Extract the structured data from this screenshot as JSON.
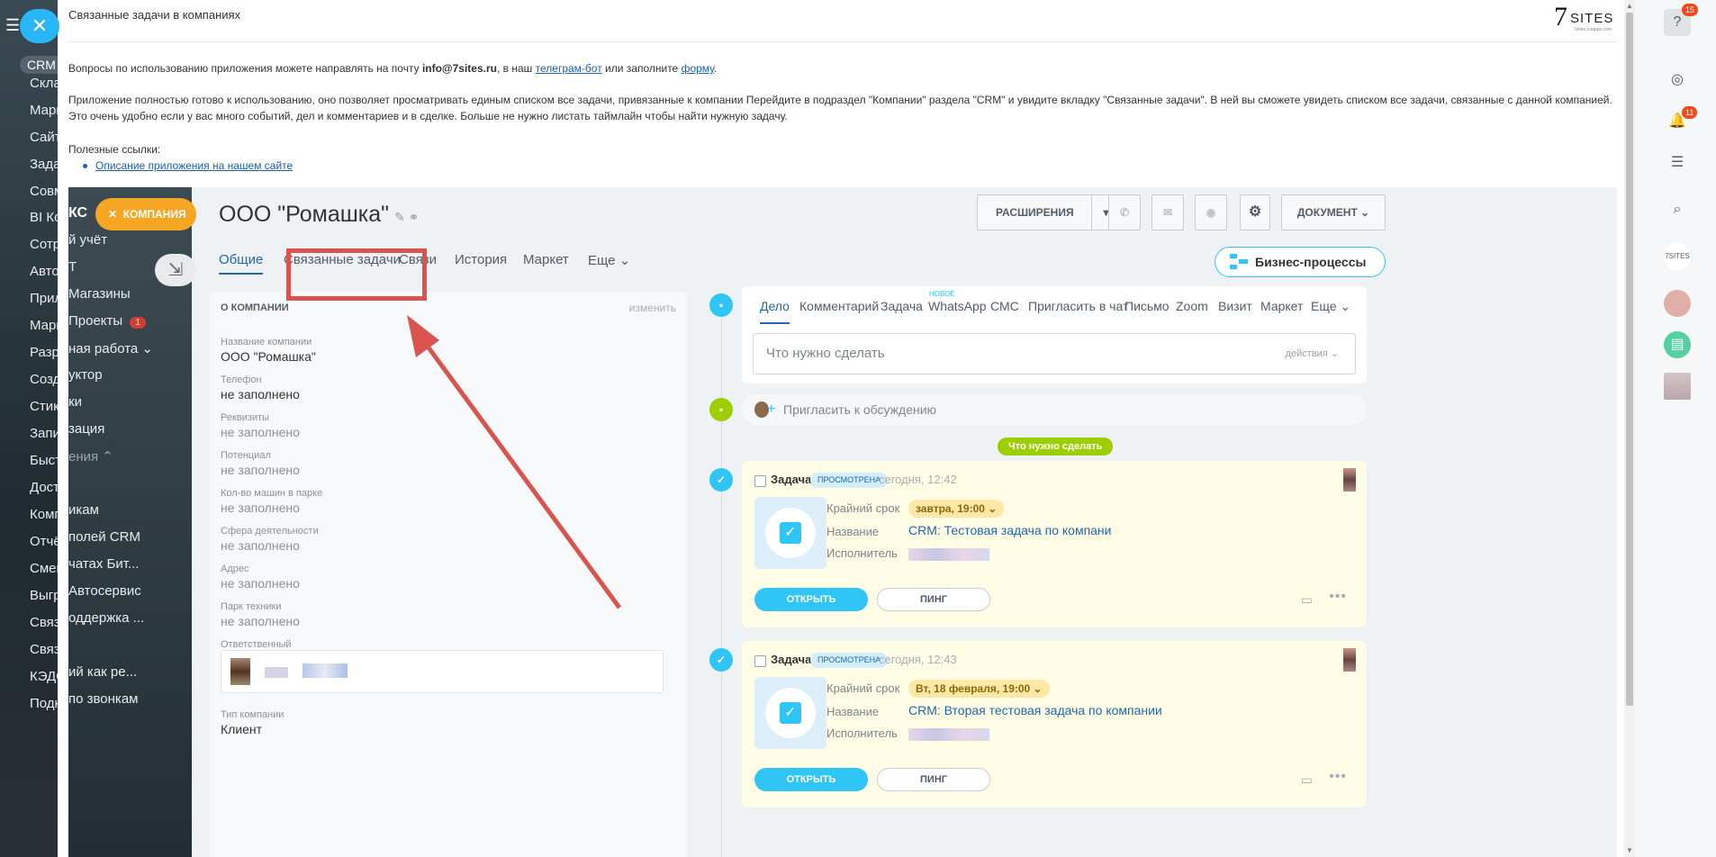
{
  "app": {
    "title": "Связанные задачи в компаниях",
    "logo": {
      "mark": "7",
      "word": "SITES",
      "sub": "7sites.ru/apps.com"
    }
  },
  "intro": {
    "p1_a": "Вопросы по использованию приложения можете направлять на почту ",
    "email": "info@7sites.ru",
    "p1_b": ", в наш ",
    "bot_link": "телеграм-бот",
    "p1_c": " или заполните ",
    "form_link": "форму",
    "p1_d": ".",
    "p2": "Приложение полностью готово к использованию, оно позволяет просматривать единым списком все задачи, привязанные к компании Перейдите в подраздел \"Компании\" раздела \"CRM\" и увидите вкладку \"Связанные задачи\". В ней вы сможете увидеть списком все задачи, связанные с данной компанией. Это очень удобно если у вас много событий, дел и комментариев и в сделке. Больше не нужно листать таймлайн чтобы найти нужную задачу.",
    "p3": "Полезные ссылки:",
    "link1": "Описание приложения на нашем сайте"
  },
  "bg_sidebar": {
    "crm": "CRM",
    "items": [
      "Склад",
      "Маркетинг",
      "Сайты",
      "Задачи",
      "Совместная работа",
      "BI Конструктор",
      "Сотрудники",
      "Автоматизация",
      "Приложения",
      "Маркет",
      "Разработчикам",
      "Создатель",
      "Стикеры",
      "Запись",
      "Быстрые",
      "Доступ",
      "Компании",
      "Отчёты",
      "Смена",
      "Выгрузка",
      "Связь",
      "Связь BI",
      "КЭДО",
      "Подключения"
    ]
  },
  "inner_sidebar": {
    "ks": "КС",
    "company_badge": "КОМПАНИЯ",
    "items": [
      {
        "label": "й учёт"
      },
      {
        "label": "Т"
      },
      {
        "label": "Магазины"
      },
      {
        "label": "Проекты",
        "badge": "1"
      },
      {
        "label": "ная работа ⌄"
      },
      {
        "label": "уктор"
      },
      {
        "label": "ки"
      },
      {
        "label": "зация"
      },
      {
        "label": "ения ⌃"
      },
      {
        "label": "икам"
      },
      {
        "label": "полей CRM"
      },
      {
        "label": "чатах Бит..."
      },
      {
        "label": "Автосервис"
      },
      {
        "label": "оддержка ..."
      },
      {
        "label": "ий как ре..."
      },
      {
        "label": "по звонкам"
      }
    ]
  },
  "company": {
    "title": "ООО \"Ромашка\"",
    "toolbar": {
      "extensions": "РАСШИРЕНИЯ",
      "document": "ДОКУМЕНТ"
    },
    "tabs": [
      "Общие",
      "Связанные задачи",
      "Связи",
      "История",
      "Маркет",
      "Еще"
    ],
    "bp_button": "Бизнес-процессы"
  },
  "about": {
    "header": "О КОМПАНИИ",
    "edit": "изменить",
    "fields": [
      {
        "label": "Название компании",
        "value": "ООО \"Ромашка\"",
        "empty": false
      },
      {
        "label": "Телефон",
        "value": "не заполнено",
        "empty": false
      },
      {
        "label": "Реквизиты",
        "value": "не заполнено",
        "empty": true
      },
      {
        "label": "Потенциал",
        "value": "не заполнено",
        "empty": true
      },
      {
        "label": "Кол-во машин в парке",
        "value": "не заполнено",
        "empty": true
      },
      {
        "label": "Сфера деятельности",
        "value": "не заполнено",
        "empty": true
      },
      {
        "label": "Адрес",
        "value": "не заполнено",
        "empty": true
      },
      {
        "label": "Парк техники",
        "value": "не заполнено",
        "empty": true
      }
    ],
    "responsible_label": "Ответственный",
    "type_label": "Тип компании",
    "type_value": "Клиент"
  },
  "timeline": {
    "tabs": [
      "Дело",
      "Комментарий",
      "Задача",
      "WhatsApp",
      "СМС",
      "Пригласить в чат",
      "Письмо",
      "Zoom",
      "Визит",
      "Маркет",
      "Еще"
    ],
    "new_label": "НОВОЕ",
    "todo_placeholder": "Что нужно сделать",
    "todo_actions": "действия",
    "invite": "Пригласить к обсуждению",
    "separator": "Что нужно сделать",
    "tasks": [
      {
        "title": "Задача",
        "badge": "ПРОСМОТРЕНА",
        "time": "сегодня, 12:42",
        "deadline_label": "Крайний срок",
        "deadline": "завтра, 19:00",
        "name_label": "Название",
        "name": "CRM: Тестовая задача по компани",
        "exec_label": "Исполнитель",
        "open": "ОТКРЫТЬ",
        "ping": "ПИНГ"
      },
      {
        "title": "Задача",
        "badge": "ПРОСМОТРЕНА",
        "time": "сегодня, 12:43",
        "deadline_label": "Крайний срок",
        "deadline": "Вт, 18 февраля, 19:00",
        "name_label": "Название",
        "name": "CRM: Вторая тестовая задача по компании",
        "exec_label": "Исполнитель",
        "open": "ОТКРЫТЬ",
        "ping": "ПИНГ"
      }
    ]
  },
  "rail": {
    "help_badge": "15",
    "notif_badge": "11",
    "sites_mark": "7SITES"
  },
  "colors": {
    "accent": "#2fc6f6",
    "link": "#2067b0",
    "highlight": "#d9534f",
    "warning": "#f5a623",
    "green": "#9dcf00"
  }
}
